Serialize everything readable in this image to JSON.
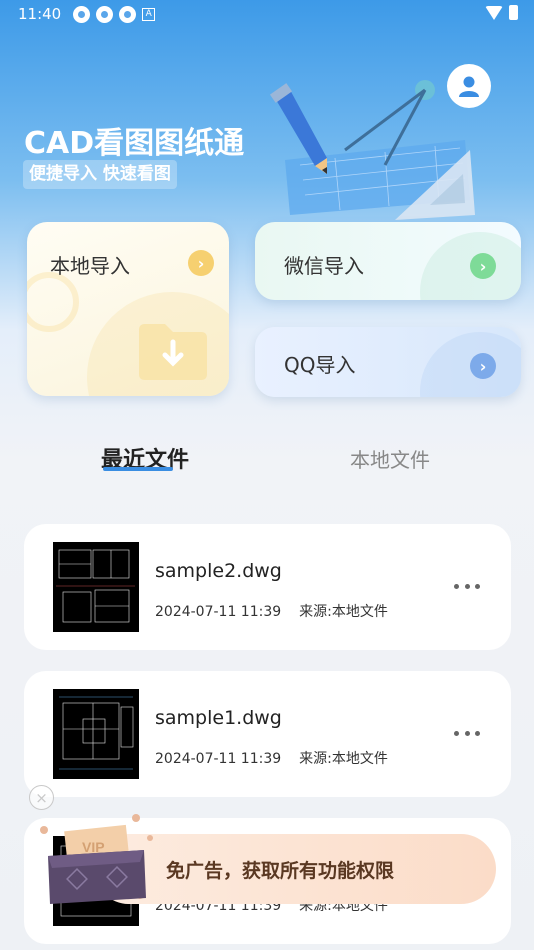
{
  "status_bar": {
    "time": "11:40",
    "notif_letter": "A"
  },
  "header": {
    "title": "CAD看图图纸通",
    "subtitle": "便捷导入 快速看图"
  },
  "import_cards": {
    "local": {
      "label": "本地导入",
      "arrow": "›"
    },
    "wechat": {
      "label": "微信导入",
      "arrow": "›"
    },
    "qq": {
      "label": "QQ导入",
      "arrow": "›"
    }
  },
  "tabs": {
    "recent": "最近文件",
    "local": "本地文件"
  },
  "files": [
    {
      "name": "sample2.dwg",
      "date": "2024-07-11 11:39",
      "source": "来源:本地文件"
    },
    {
      "name": "sample1.dwg",
      "date": "2024-07-11 11:39",
      "source": "来源:本地文件"
    },
    {
      "name": "",
      "date": "2024-07-11 11:39",
      "source": "来源:本地文件"
    }
  ],
  "ad": {
    "text": "免广告，获取所有功能权限",
    "close": "×",
    "vip_label": "VIP"
  },
  "colors": {
    "accent": "#3a8de2",
    "wechat": "#7edb98",
    "qq": "#7daaea",
    "local": "#f6d070"
  }
}
